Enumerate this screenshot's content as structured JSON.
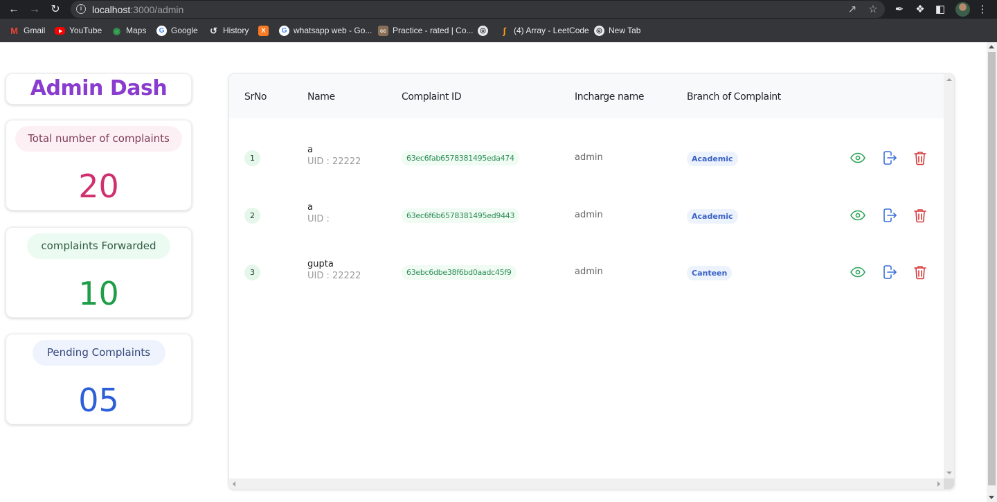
{
  "browser": {
    "url_host": "localhost",
    "url_path": ":3000/admin",
    "bookmarks": [
      {
        "label": "Gmail",
        "icon": "gmail-icon"
      },
      {
        "label": "YouTube",
        "icon": "youtube-icon"
      },
      {
        "label": "Maps",
        "icon": "maps-icon"
      },
      {
        "label": "Google",
        "icon": "google-icon"
      },
      {
        "label": "History",
        "icon": "history-icon"
      },
      {
        "label": "",
        "icon": "xampp-icon"
      },
      {
        "label": "whatsapp web - Go...",
        "icon": "google-icon"
      },
      {
        "label": "Practice - rated | Co...",
        "icon": "codechef-icon"
      },
      {
        "label": "",
        "icon": "globe-icon"
      },
      {
        "label": "(4) Array - LeetCode",
        "icon": "leetcode-icon"
      },
      {
        "label": "New Tab",
        "icon": "globe-icon"
      }
    ]
  },
  "sidebar": {
    "title": "Admin Dash",
    "stats": [
      {
        "label": "Total number of complaints",
        "value": "20",
        "color": "#d0306f"
      },
      {
        "label": "complaints Forwarded",
        "value": "10",
        "color": "#1f9d48"
      },
      {
        "label": "Pending Complaints",
        "value": "05",
        "color": "#2d5fd8"
      }
    ]
  },
  "table": {
    "columns": [
      "SrNo",
      "Name",
      "Complaint ID",
      "Incharge name",
      "Branch of Complaint"
    ],
    "rows": [
      {
        "srno": "1",
        "name": "a",
        "uid": "UID : 22222",
        "complaint_id": "63ec6fab6578381495eda474",
        "incharge": "admin",
        "branch": "Academic"
      },
      {
        "srno": "2",
        "name": "a",
        "uid": "UID :",
        "complaint_id": "63ec6f6b6578381495ed9443",
        "incharge": "admin",
        "branch": "Academic"
      },
      {
        "srno": "3",
        "name": "gupta",
        "uid": "UID : 22222",
        "complaint_id": "63ebc6dbe38f6bd0aadc45f9",
        "incharge": "admin",
        "branch": "Canteen"
      }
    ],
    "actions": {
      "view": "eye-icon",
      "forward": "forward-icon",
      "delete": "trash-icon"
    },
    "colors": {
      "view": "#2fa35a",
      "forward": "#3a6fd8",
      "delete": "#d63a3a"
    }
  }
}
